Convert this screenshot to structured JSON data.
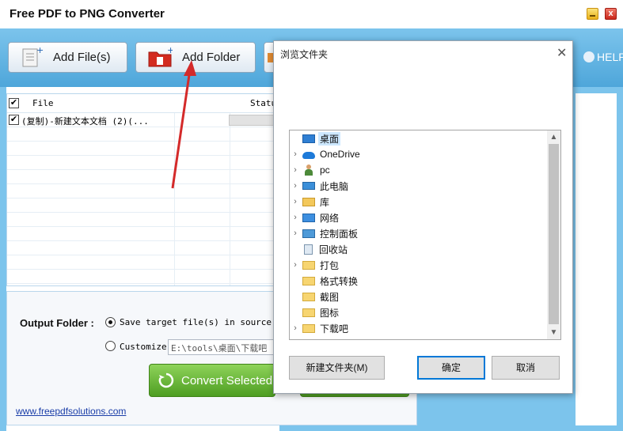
{
  "window": {
    "title": "Free PDF to PNG Converter",
    "close_glyph": "x"
  },
  "toolbar": {
    "add_files": "Add File(s)",
    "add_folder": "Add Folder",
    "help": "HELP"
  },
  "file_list": {
    "col_file": "File",
    "col_status": "Statu",
    "rows": [
      {
        "name": "(复制)-新建文本文档 (2)(...",
        "checked": true
      }
    ]
  },
  "output": {
    "label": "Output Folder :",
    "option_source": "Save target file(s) in source fo",
    "option_custom": "Customize",
    "custom_path": "E:\\tools\\桌面\\下载吧",
    "selected": "source"
  },
  "convert_label": "Convert Selected",
  "site_link": "www.freepdfsolutions.com",
  "dialog": {
    "title": "浏览文件夹",
    "close_glyph": "✕",
    "tree": [
      {
        "label": "桌面",
        "icon": "desktop-icon",
        "selected": true,
        "expander": ""
      },
      {
        "label": "OneDrive",
        "icon": "cloud-icon",
        "expander": "›"
      },
      {
        "label": "pc",
        "icon": "user-icon",
        "expander": "›"
      },
      {
        "label": "此电脑",
        "icon": "computer-icon",
        "expander": "›"
      },
      {
        "label": "库",
        "icon": "library-icon",
        "expander": "›"
      },
      {
        "label": "网络",
        "icon": "network-icon",
        "expander": "›"
      },
      {
        "label": "控制面板",
        "icon": "control-panel-icon",
        "expander": "›"
      },
      {
        "label": "回收站",
        "icon": "recycle-bin-icon",
        "expander": ""
      },
      {
        "label": "打包",
        "icon": "folder-icon",
        "expander": "›"
      },
      {
        "label": "格式转换",
        "icon": "folder-icon",
        "expander": ""
      },
      {
        "label": "截图",
        "icon": "folder-icon",
        "expander": ""
      },
      {
        "label": "图标",
        "icon": "folder-icon",
        "expander": ""
      },
      {
        "label": "下载吧",
        "icon": "folder-icon",
        "expander": "›"
      }
    ],
    "new_folder": "新建文件夹(M)",
    "ok": "确定",
    "cancel": "取消"
  },
  "colors": {
    "toolbar": "#4ea6da",
    "convert": "#5aa82a",
    "selection": "#cde8ff",
    "arrow": "#d42a2a"
  }
}
